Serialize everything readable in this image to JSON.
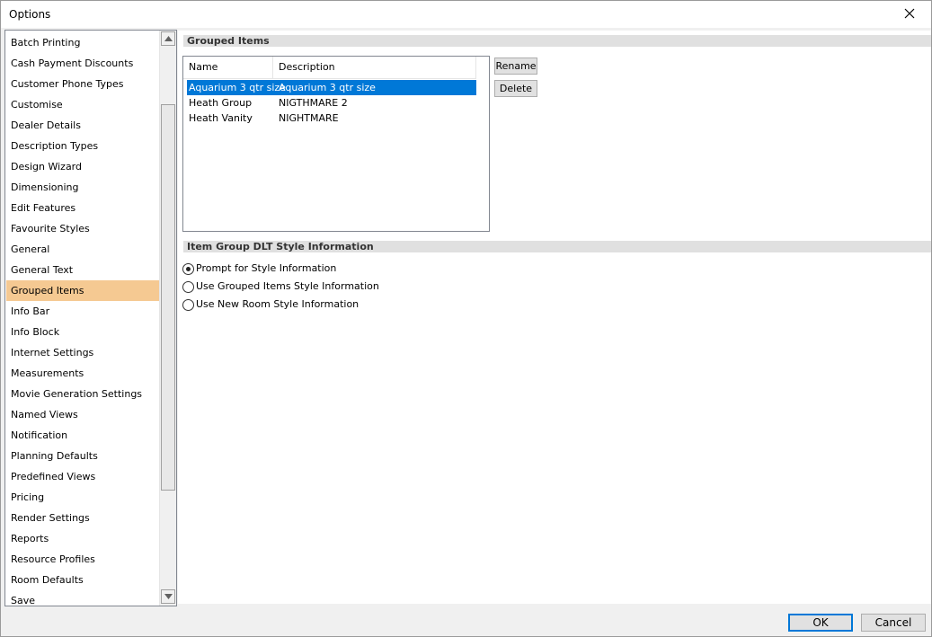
{
  "window": {
    "title": "Options"
  },
  "sidebar": {
    "items": [
      {
        "label": "Batch Printing"
      },
      {
        "label": "Cash Payment Discounts"
      },
      {
        "label": "Customer Phone Types"
      },
      {
        "label": "Customise"
      },
      {
        "label": "Dealer Details"
      },
      {
        "label": "Description Types"
      },
      {
        "label": "Design Wizard"
      },
      {
        "label": "Dimensioning"
      },
      {
        "label": "Edit Features"
      },
      {
        "label": "Favourite Styles"
      },
      {
        "label": "General"
      },
      {
        "label": "General Text"
      },
      {
        "label": "Grouped Items",
        "selected": true
      },
      {
        "label": "Info Bar"
      },
      {
        "label": "Info Block"
      },
      {
        "label": "Internet Settings"
      },
      {
        "label": "Measurements"
      },
      {
        "label": "Movie Generation Settings"
      },
      {
        "label": "Named Views"
      },
      {
        "label": "Notification"
      },
      {
        "label": "Planning Defaults"
      },
      {
        "label": "Predefined Views"
      },
      {
        "label": "Pricing"
      },
      {
        "label": "Render Settings"
      },
      {
        "label": "Reports"
      },
      {
        "label": "Resource Profiles"
      },
      {
        "label": "Room Defaults"
      },
      {
        "label": "Save"
      }
    ]
  },
  "grouped_items": {
    "header": "Grouped Items",
    "columns": {
      "name": "Name",
      "description": "Description"
    },
    "rows": [
      {
        "name": "Aquarium 3 qtr size",
        "description": "Aquarium 3 qtr size",
        "selected": true
      },
      {
        "name": "Heath Group",
        "description": "NIGTHMARE 2"
      },
      {
        "name": "Heath Vanity",
        "description": "NIGHTMARE"
      }
    ],
    "rename_label": "Rename",
    "delete_label": "Delete"
  },
  "style_info": {
    "header": "Item Group DLT Style Information",
    "options": [
      {
        "label": "Prompt for Style Information",
        "checked": true
      },
      {
        "label": "Use Grouped Items Style Information",
        "checked": false
      },
      {
        "label": "Use New Room Style Information",
        "checked": false
      }
    ]
  },
  "footer": {
    "ok_label": "OK",
    "cancel_label": "Cancel"
  },
  "colors": {
    "selection_sidebar": "#f5c992",
    "selection_grid": "#0078d7",
    "accent": "#0078d7"
  }
}
